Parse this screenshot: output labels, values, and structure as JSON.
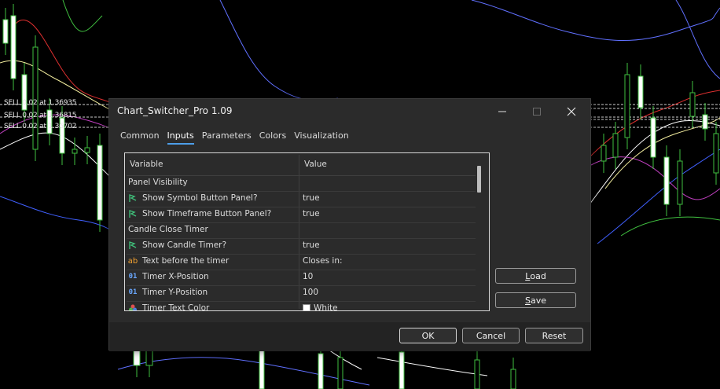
{
  "chart": {
    "trade_labels": [
      "SELL 0.02 at 1.36935",
      "SELL 0.02 at 1.36815",
      "SELL 0.02 at 1.36702"
    ]
  },
  "dialog": {
    "title": "Chart_Switcher_Pro 1.09",
    "tabs": [
      {
        "label": "Common",
        "active": false
      },
      {
        "label": "Inputs",
        "active": true
      },
      {
        "label": "Parameters",
        "active": false
      },
      {
        "label": "Colors",
        "active": false
      },
      {
        "label": "Visualization",
        "active": false
      }
    ],
    "grid": {
      "header_variable": "Variable",
      "header_value": "Value",
      "rows": [
        {
          "icon": "none",
          "name": "Panel Visibility",
          "value": ""
        },
        {
          "icon": "bool-arrow-icon",
          "name": "Show Symbol Button Panel?",
          "value": "true"
        },
        {
          "icon": "bool-arrow-icon",
          "name": "Show Timeframe Button Panel?",
          "value": "true"
        },
        {
          "icon": "none",
          "name": "Candle Close Timer",
          "value": ""
        },
        {
          "icon": "bool-arrow-icon",
          "name": "Show Candle Timer?",
          "value": "true"
        },
        {
          "icon": "string-ab-icon",
          "name": "Text before the timer",
          "value": "Closes in:"
        },
        {
          "icon": "int-01-icon",
          "name": "Timer X-Position",
          "value": "10"
        },
        {
          "icon": "int-01-icon",
          "name": "Timer Y-Position",
          "value": "100"
        },
        {
          "icon": "color-palette-icon",
          "name": "Timer Text Color",
          "value": "White",
          "swatch": "#ffffff"
        }
      ]
    },
    "buttons": {
      "load_first": "L",
      "load_rest": "oad",
      "save_first": "S",
      "save_rest": "ave",
      "ok": "OK",
      "cancel": "Cancel",
      "reset": "Reset"
    },
    "icons": {
      "ab": "ab",
      "int": "01"
    },
    "colors": {
      "accent": "#4c9ee8",
      "dialog_bg": "#2b2b2b"
    }
  }
}
